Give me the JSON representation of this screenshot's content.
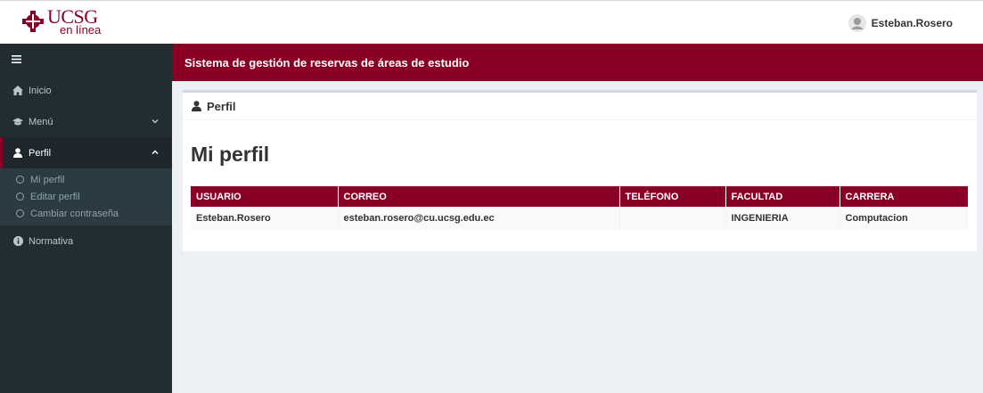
{
  "brand": {
    "logo_main": "UCSG",
    "logo_sub": "en línea",
    "accent": "#8a0024"
  },
  "topbar": {
    "username": "Esteban.Rosero"
  },
  "header": {
    "title": "Sistema de gestión de reservas de áreas de estudio"
  },
  "sidebar": {
    "toggle_icon": "hamburger-icon",
    "items": [
      {
        "label": "Inicio",
        "icon": "home-icon"
      },
      {
        "label": "Menú",
        "icon": "graduation-cap-icon"
      },
      {
        "label": "Perfil",
        "icon": "user-icon"
      },
      {
        "label": "Normativa",
        "icon": "info-icon"
      }
    ],
    "perfil_subitems": [
      "Mi perfil",
      "Editar perfil",
      "Cambiar contraseña"
    ]
  },
  "box": {
    "header": "Perfil",
    "page_title": "Mi perfil"
  },
  "table": {
    "headers": [
      "USUARIO",
      "CORREO",
      "TELÉFONO",
      "FACULTAD",
      "CARRERA"
    ],
    "rows": [
      [
        "Esteban.Rosero",
        "esteban.rosero@cu.ucsg.edu.ec",
        "",
        "INGENIERIA",
        "Computacion"
      ]
    ]
  }
}
